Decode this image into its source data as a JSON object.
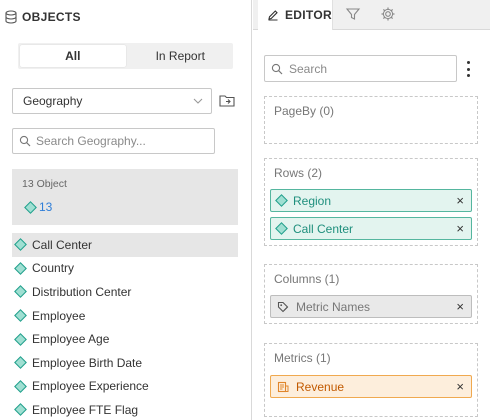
{
  "left_panel": {
    "header_title": "OBJECTS",
    "segment": {
      "all_label": "All",
      "in_report_label": "In Report"
    },
    "dropdown_value": "Geography",
    "search_placeholder": "Search Geography...",
    "object_count_label": "13 Object",
    "object_count_value": "13",
    "attributes": [
      "Call Center",
      "Country",
      "Distribution Center",
      "Employee",
      "Employee Age",
      "Employee Birth Date",
      "Employee Experience",
      "Employee FTE Flag"
    ],
    "selected_index": 0
  },
  "right_panel": {
    "tab_editor_label": "EDITOR",
    "search_placeholder": "Search",
    "zones": {
      "pageby": {
        "label": "PageBy (0)",
        "items": []
      },
      "rows": {
        "label": "Rows (2)",
        "items": [
          "Region",
          "Call Center"
        ]
      },
      "columns": {
        "label": "Columns (1)",
        "items": [
          "Metric Names"
        ]
      },
      "metrics": {
        "label": "Metrics (1)",
        "items": [
          "Revenue"
        ]
      }
    },
    "remove_glyph": "×"
  },
  "colors": {
    "attribute_green": "#1e9e8a",
    "link_blue": "#2f7ed8",
    "metric_orange": "#f0a94f",
    "selected_bg": "#e6e6e6"
  },
  "icons": [
    "database-icon",
    "chevron-down-icon",
    "folder-icon",
    "search-icon",
    "diamond-attribute-icon",
    "pencil-icon",
    "filter-icon",
    "gear-icon",
    "kebab-menu-icon",
    "tag-icon",
    "metric-icon",
    "close-icon"
  ]
}
